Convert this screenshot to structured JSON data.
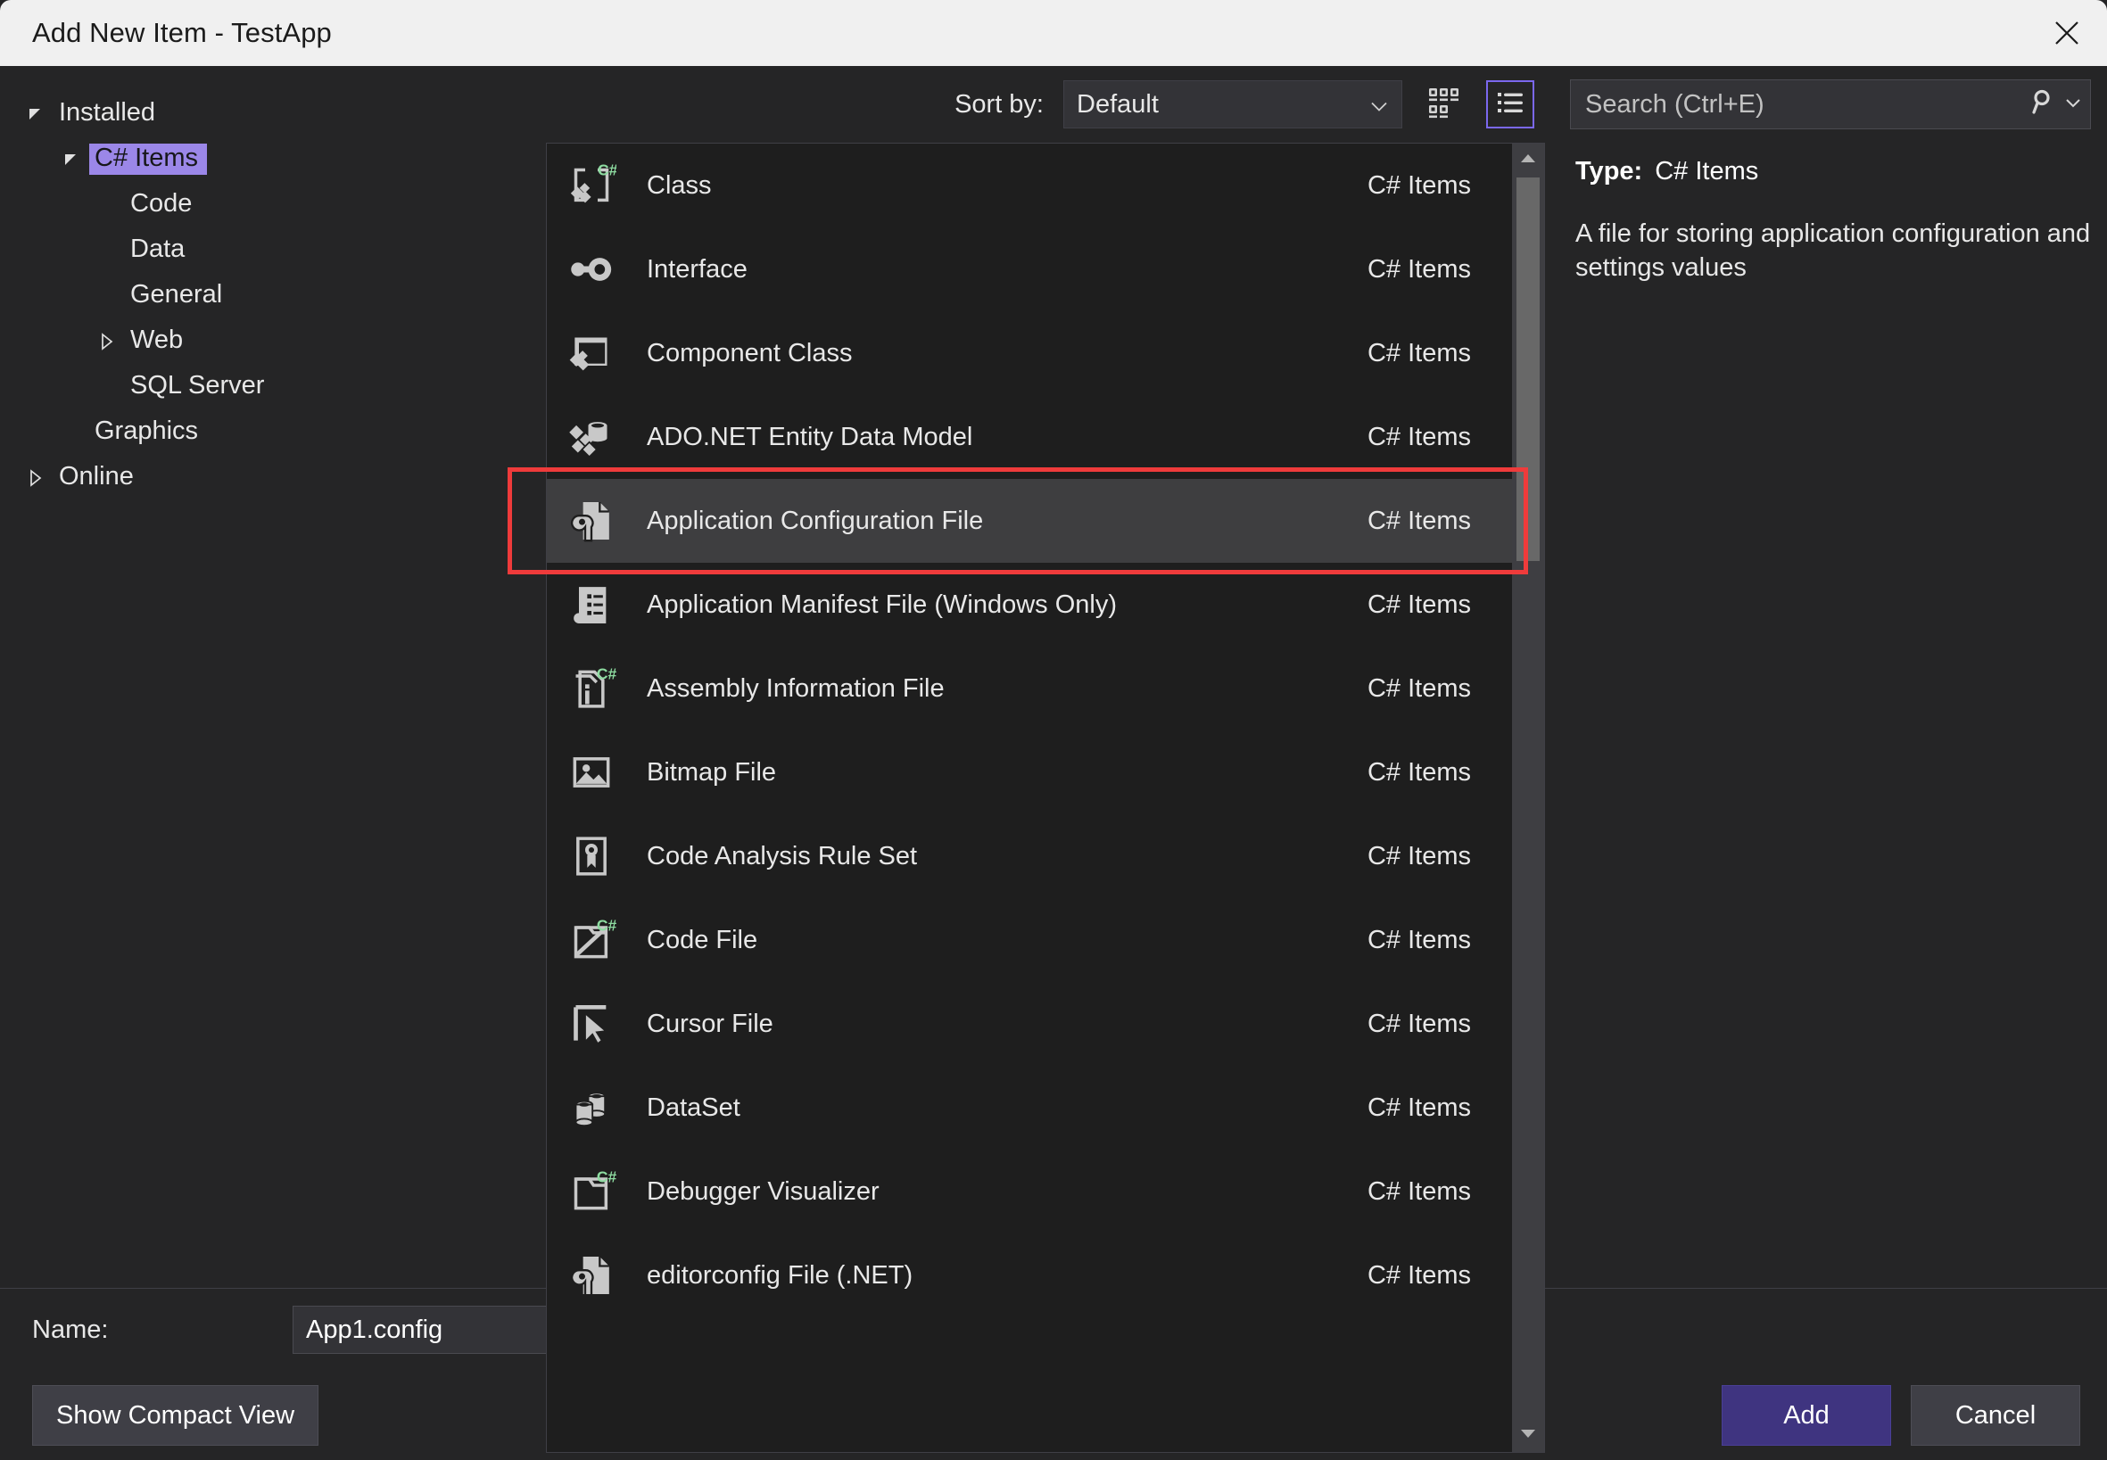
{
  "window": {
    "title": "Add New Item - TestApp",
    "close_icon": "close-icon"
  },
  "sidebar": {
    "nodes": [
      {
        "label": "Installed",
        "level": 0,
        "twisty": "expanded",
        "selected": false
      },
      {
        "label": "C# Items",
        "level": 1,
        "twisty": "expanded",
        "selected": true
      },
      {
        "label": "Code",
        "level": 2,
        "twisty": "none",
        "selected": false
      },
      {
        "label": "Data",
        "level": 2,
        "twisty": "none",
        "selected": false
      },
      {
        "label": "General",
        "level": 2,
        "twisty": "none",
        "selected": false
      },
      {
        "label": "Web",
        "level": 2,
        "twisty": "collapsed",
        "selected": false
      },
      {
        "label": "SQL Server",
        "level": 2,
        "twisty": "none",
        "selected": false
      },
      {
        "label": "Graphics",
        "level": 1,
        "twisty": "none",
        "selected": false
      },
      {
        "label": "Online",
        "level": 0,
        "twisty": "collapsed",
        "selected": false
      }
    ]
  },
  "toolbar": {
    "sort_by_label": "Sort by:",
    "sort_by_value": "Default",
    "tiles_view_icon": "grid-view-icon",
    "list_view_icon": "list-view-icon",
    "active_view": "list"
  },
  "search": {
    "placeholder": "Search (Ctrl+E)",
    "icon": "search-icon",
    "dropdown_icon": "chevron-down-icon"
  },
  "details": {
    "type_label": "Type:",
    "type_value": "C# Items",
    "description": "A file for storing application configuration and settings values"
  },
  "templates": {
    "items": [
      {
        "name": "Class",
        "category": "C# Items",
        "icon": "class-csharp-icon",
        "selected": false
      },
      {
        "name": "Interface",
        "category": "C# Items",
        "icon": "interface-icon",
        "selected": false
      },
      {
        "name": "Component Class",
        "category": "C# Items",
        "icon": "component-class-icon",
        "selected": false
      },
      {
        "name": "ADO.NET Entity Data Model",
        "category": "C# Items",
        "icon": "entity-data-model-icon",
        "selected": false
      },
      {
        "name": "Application Configuration File",
        "category": "C# Items",
        "icon": "config-file-wrench-icon",
        "selected": true
      },
      {
        "name": "Application Manifest File (Windows Only)",
        "category": "C# Items",
        "icon": "manifest-file-icon",
        "selected": false
      },
      {
        "name": "Assembly Information File",
        "category": "C# Items",
        "icon": "assembly-info-csharp-icon",
        "selected": false
      },
      {
        "name": "Bitmap File",
        "category": "C# Items",
        "icon": "bitmap-image-icon",
        "selected": false
      },
      {
        "name": "Code Analysis Rule Set",
        "category": "C# Items",
        "icon": "rule-set-ribbon-icon",
        "selected": false
      },
      {
        "name": "Code File",
        "category": "C# Items",
        "icon": "code-file-csharp-icon",
        "selected": false
      },
      {
        "name": "Cursor File",
        "category": "C# Items",
        "icon": "cursor-arrow-icon",
        "selected": false
      },
      {
        "name": "DataSet",
        "category": "C# Items",
        "icon": "dataset-cylinders-icon",
        "selected": false
      },
      {
        "name": "Debugger Visualizer",
        "category": "C# Items",
        "icon": "debugger-visualizer-csharp-icon",
        "selected": false
      },
      {
        "name": "editorconfig File (.NET)",
        "category": "C# Items",
        "icon": "config-file-wrench-icon",
        "selected": false
      }
    ]
  },
  "scrollbar": {
    "up_arrow_icon": "scroll-up-icon",
    "down_arrow_icon": "scroll-down-icon"
  },
  "bottom": {
    "name_label": "Name:",
    "name_value": "App1.config",
    "compact_view_label": "Show Compact View",
    "add_label": "Add",
    "cancel_label": "Cancel"
  },
  "colors": {
    "accent_purple": "#9b87e8",
    "add_button": "#3f3480",
    "selection_row": "#3e3e40",
    "annotation_red": "#ef3b3b",
    "csharp_green": "#8ddba0",
    "titlebar": "#f0f0f0"
  }
}
